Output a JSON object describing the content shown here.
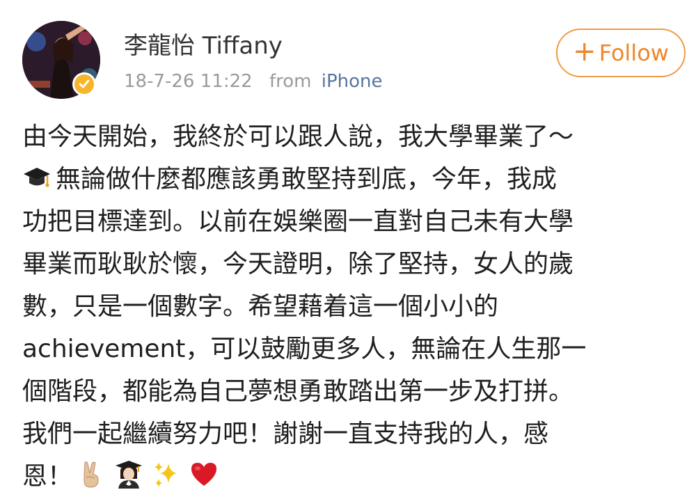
{
  "post": {
    "author": {
      "name": "李龍怡 Tiffany",
      "verified": true,
      "badge_color": "#f6b52a"
    },
    "timestamp": "18-7-26 11:22",
    "source_prefix": "from",
    "source_device": "iPhone",
    "follow_button": {
      "label": "+Follow",
      "plus": "+",
      "text": "Follow",
      "color": "#f0862a"
    },
    "lines": [
      "由今天開始，我終於可以跟人說，我大學畢業了～",
      "無論做什麼都應該勇敢堅持到底，今年，我成",
      "功把目標達到。以前在娛樂圈一直對自己未有大學",
      "畢業而耿耿於懷，今天證明，除了堅持，女人的歲",
      "數，只是一個數字。希望藉着這一個小小的",
      "achievement，可以鼓勵更多人，無論在人生那一",
      "個階段，都能為自己夢想勇敢踏出第一步及打拼。",
      "我們一起繼續努力吧！謝謝一直支持我的人，感",
      "恩！"
    ],
    "emojis": {
      "graduation_cap": "graduation-cap-icon",
      "victory_hand": "victory-hand-icon",
      "graduate": "woman-graduate-icon",
      "sparkles": "sparkles-icon",
      "heart": "red-heart-icon"
    }
  }
}
